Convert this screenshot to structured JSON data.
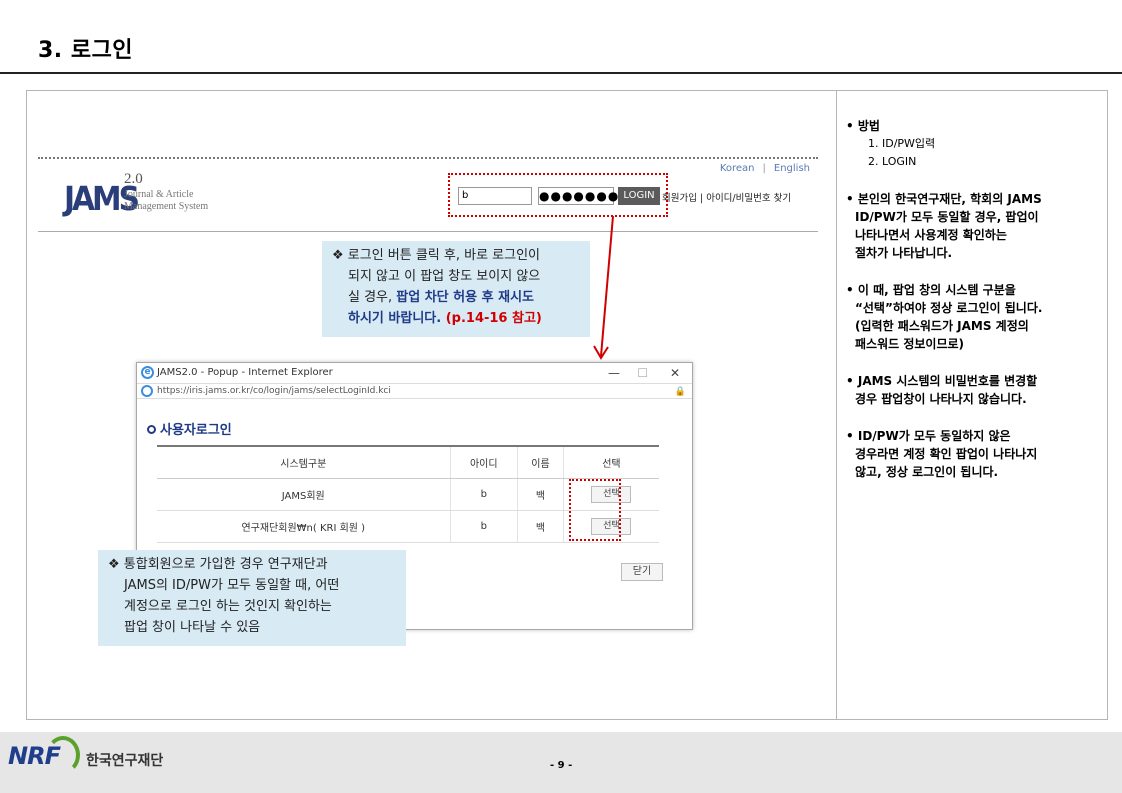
{
  "title": "3. 로그인",
  "jams": {
    "logo": "JAMS",
    "version": "2.0",
    "subtitle_line1": "Journal & Article",
    "subtitle_line2": "Management System",
    "lang_korean": "Korean",
    "lang_sep": "|",
    "lang_english": "English",
    "id_value": "b",
    "pw_value": "●●●●●●●",
    "login_label": "LOGIN",
    "member_links": "회원가입 | 아이디/비밀번호 찾기"
  },
  "callout1": {
    "line1": "❖ 로그인 버튼 클릭 후, 바로 로그인이",
    "line2": "되지 않고 이 팝업 창도 보이지 않으",
    "line3a": "실 경우, ",
    "line3b": "팝업 차단 허용 후 재시도",
    "line4a": "하시기 바랍니다.",
    "line4b": " (p.14-16 참고)"
  },
  "popup": {
    "window_title": "JAMS2.0 - Popup - Internet Explorer",
    "min": "—",
    "max": "☐",
    "close": "✕",
    "url": "https://iris.jams.or.kr/co/login/jams/selectLoginId.kci",
    "heading": "사용자로그인",
    "columns": [
      "시스템구분",
      "아이디",
      "이름",
      "선택"
    ],
    "rows": [
      {
        "system": "JAMS회원",
        "id": "b",
        "name": "백",
        "select": "선택"
      },
      {
        "system": "연구재단회원₩n( KRI 회원 )",
        "id": "b",
        "name": "백",
        "select": "선택"
      }
    ],
    "close_label": "닫기"
  },
  "callout2": {
    "line1": "❖ 통합회원으로 가입한 경우 연구재단과",
    "line2": "JAMS의 ID/PW가 모두 동일할 때, 어떤",
    "line3": "계정으로 로그인 하는 것인지 확인하는",
    "line4": "팝업 창이 나타날 수 있음"
  },
  "notes": [
    {
      "lines": [
        "• 방법"
      ],
      "sub": [
        "1.  ID/PW입력",
        "2. LOGIN"
      ]
    },
    {
      "lines": [
        "• 본인의 한국연구재단, 학회의 JAMS",
        "ID/PW가 모두 동일할 경우, 팝업이",
        "나타나면서  사용계정  확인하는",
        "절차가 나타납니다."
      ]
    },
    {
      "lines": [
        "• 이 때, 팝업 창의 시스템 구분을",
        "“선택”하여야 정상 로그인이 됩니다.",
        "(입력한 패스워드가 JAMS 계정의",
        "패스워드 정보이므로)"
      ]
    },
    {
      "lines": [
        "• JAMS 시스템의  비밀번호를  변경할",
        "경우 팝업창이 나타나지 않습니다."
      ]
    },
    {
      "lines": [
        "• ID/PW가 모두 동일하지 않은",
        "경우라면 계정 확인 팝업이 나타나지",
        "않고, 정상 로그인이 됩니다."
      ]
    }
  ],
  "footer": {
    "logo": "NRF",
    "org": "한국연구재단",
    "page": "- 9 -"
  },
  "colors": {
    "accent_red": "#d00000",
    "accent_blue": "#1f3b88",
    "callout_bg": "#d8eaf4"
  }
}
